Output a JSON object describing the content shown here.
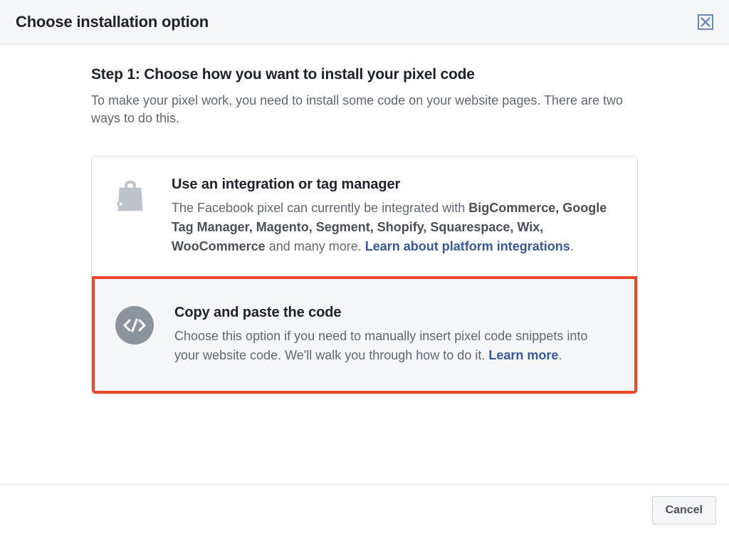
{
  "header": {
    "title": "Choose installation option"
  },
  "step": {
    "heading": "Step 1: Choose how you want to install your pixel code",
    "description": "To make your pixel work, you need to install some code on your website pages. There are two ways to do this."
  },
  "option1": {
    "title": "Use an integration or tag manager",
    "text_before": "The Facebook pixel can currently be integrated with ",
    "platforms": "BigCommerce, Google Tag Manager, Magento, Segment, Shopify, Squarespace, Wix, WooCommerce",
    "text_after": " and many more. ",
    "link": "Learn about platform integrations",
    "period": "."
  },
  "option2": {
    "title": "Copy and paste the code",
    "text": "Choose this option if you need to manually insert pixel code snippets into your website code. We'll walk you through how to do it. ",
    "link": "Learn more",
    "period": "."
  },
  "footer": {
    "cancel": "Cancel"
  }
}
